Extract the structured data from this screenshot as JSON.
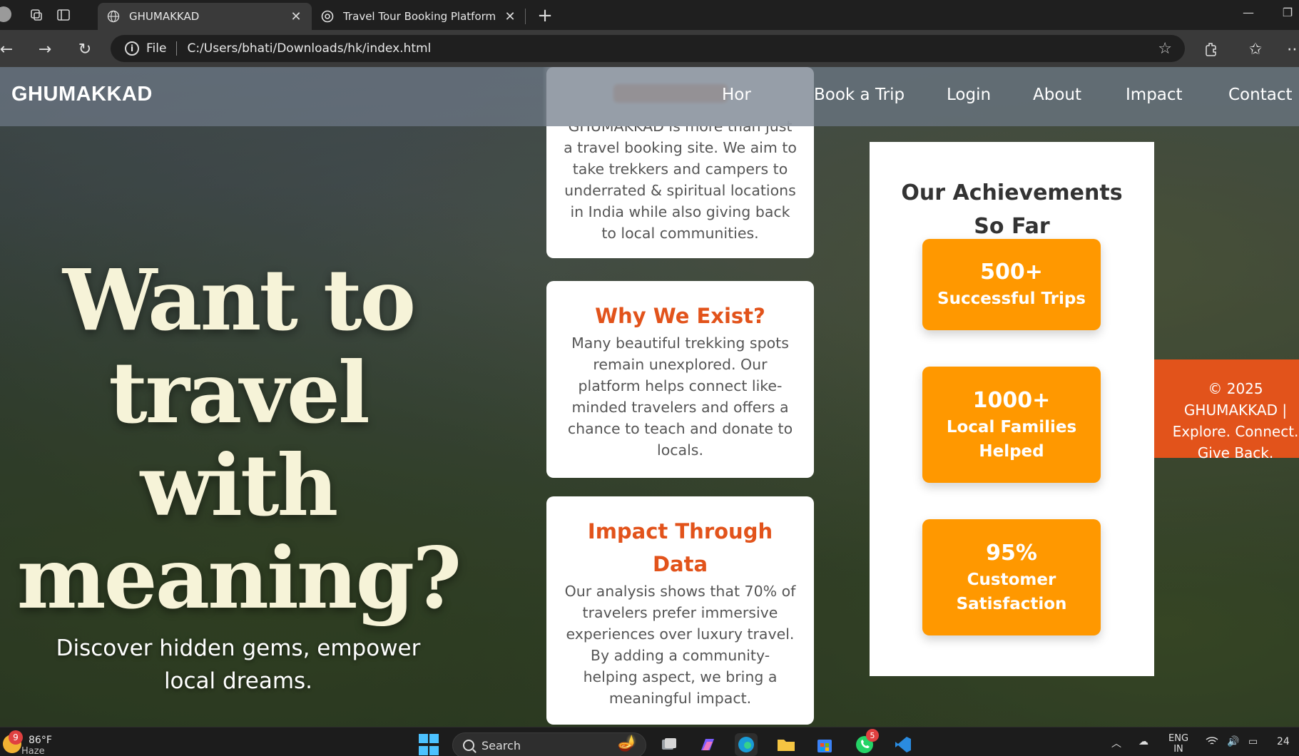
{
  "browser": {
    "tabs": [
      {
        "title": "GHUMAKKAD",
        "active": true
      },
      {
        "title": "Travel Tour Booking Platform",
        "active": false
      }
    ],
    "address": {
      "scheme_label": "File",
      "url": "C:/Users/bhati/Downloads/hk/index.html"
    }
  },
  "site": {
    "brand": "GHUMAKKAD",
    "nav": [
      "Home",
      "Book a Trip",
      "Login",
      "About",
      "Impact",
      "Contact"
    ],
    "nav_partial_home": "Hor",
    "hero": {
      "title": "Want to travel with meaning?",
      "subtitle": "Discover hidden gems, empower local dreams."
    },
    "cards": [
      {
        "title": "",
        "text": "GHUMAKKAD is more than just a travel booking site. We aim to take trekkers and campers to underrated & spiritual locations in India while also giving back to local communities."
      },
      {
        "title": "Why We Exist?",
        "text": "Many beautiful trekking spots remain unexplored. Our platform helps connect like-minded travelers and offers a chance to teach and donate to locals."
      },
      {
        "title": "Impact Through Data",
        "text": "Our analysis shows that 70% of travelers prefer immersive experiences over luxury travel. By adding a community-helping aspect, we bring a meaningful impact."
      }
    ],
    "achievements": {
      "title": "Our Achievements So Far",
      "stats": [
        {
          "number": "500+",
          "label": "Successful Trips"
        },
        {
          "number": "1000+",
          "label": "Local Families Helped"
        },
        {
          "number": "95%",
          "label": "Customer Satisfaction"
        }
      ]
    },
    "footer": "© 2025 GHUMAKKAD | Explore. Connect. Give Back.",
    "colors": {
      "accent": "#e2531b",
      "stat_bg": "#ff9800",
      "hero_text": "#f6f3d8"
    }
  },
  "taskbar": {
    "weather": {
      "temp": "86°F",
      "condition": "Haze",
      "badge": "9"
    },
    "search_placeholder": "Search",
    "whatsapp_badge": "5",
    "language": "ENG",
    "region": "IN",
    "clock": "24"
  }
}
